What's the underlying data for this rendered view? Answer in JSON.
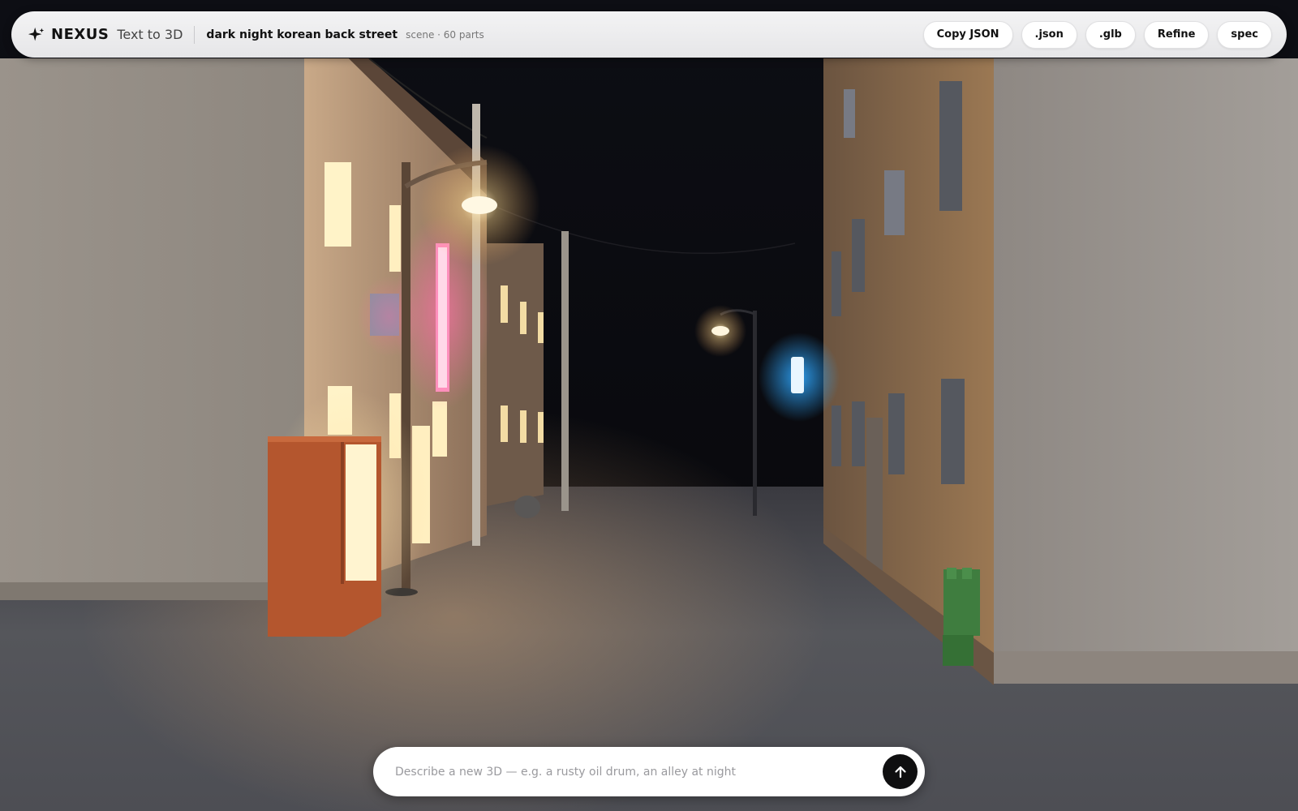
{
  "app": {
    "brand_name": "NEXUS",
    "brand_sub": "Text to 3D",
    "brand_icon": "sparkle-icon"
  },
  "scene": {
    "title": "dark night korean back street",
    "meta": "scene · 60 parts"
  },
  "toolbar": {
    "copy_json_label": "Copy JSON",
    "json_label": ".json",
    "glb_label": ".glb",
    "refine_label": "Refine",
    "spec_label": "spec"
  },
  "prompt": {
    "placeholder": "Describe a new 3D — e.g. a rusty oil drum, an alley at night",
    "value": "",
    "send_icon": "arrow-up-icon"
  },
  "colors": {
    "lamp_glow": "#ffe7a8",
    "neon_pink": "#ff6fa8",
    "neon_blue": "#2fa8ff",
    "vending_machine": "#b4562e",
    "green_bin": "#3f7d3f"
  }
}
